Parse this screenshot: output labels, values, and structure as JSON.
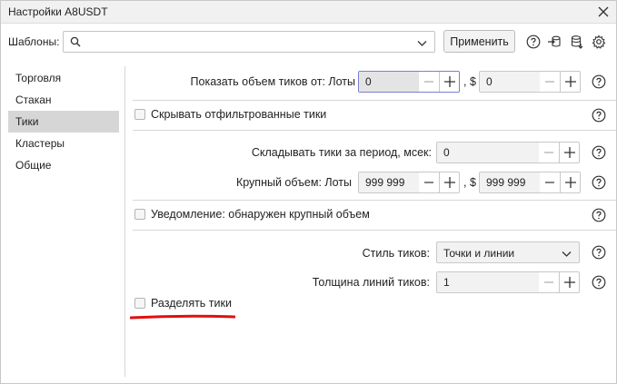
{
  "window": {
    "title": "Настройки A8USDT"
  },
  "toolbar": {
    "templates_label": "Шаблоны:",
    "search_value": "",
    "apply_label": "Применить"
  },
  "sidebar": {
    "items": [
      {
        "label": "Торговля"
      },
      {
        "label": "Стакан"
      },
      {
        "label": "Тики",
        "active": true
      },
      {
        "label": "Кластеры"
      },
      {
        "label": "Общие"
      }
    ]
  },
  "ticks": {
    "show_volume_label": "Показать объем тиков от: Лоты",
    "show_volume_lots": "0",
    "show_volume_usd": "0",
    "currency_sep": ", $",
    "hide_filtered_label": "Скрывать отфильтрованные тики",
    "sum_period_label": "Складывать тики за период, мсек:",
    "sum_period_value": "0",
    "big_volume_label": "Крупный объем: Лоты",
    "big_volume_lots": "999 999",
    "big_volume_usd": "999 999",
    "notify_label": "Уведомление: обнаружен крупный объем",
    "style_label": "Стиль тиков:",
    "style_value": "Точки и линии",
    "line_width_label": "Толщина линий тиков:",
    "line_width_value": "1",
    "split_label": "Разделять тики"
  },
  "colors": {
    "annotation": "#e01010",
    "focus_border": "#7b7fd0"
  }
}
